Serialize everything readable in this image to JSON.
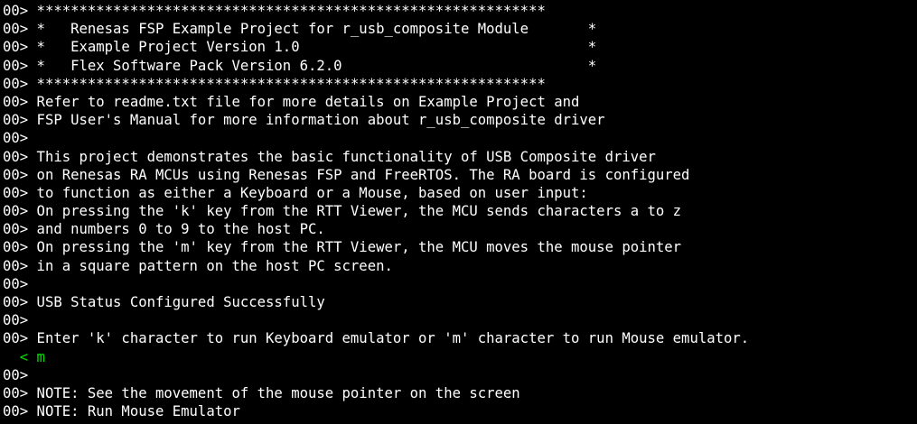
{
  "terminal": {
    "lines": [
      {
        "text": "00> ************************************************************",
        "type": "output"
      },
      {
        "text": "00> *   Renesas FSP Example Project for r_usb_composite Module       *",
        "type": "output"
      },
      {
        "text": "00> *   Example Project Version 1.0                                  *",
        "type": "output"
      },
      {
        "text": "00> *   Flex Software Pack Version 6.2.0                             *",
        "type": "output"
      },
      {
        "text": "00> ************************************************************",
        "type": "output"
      },
      {
        "text": "00> Refer to readme.txt file for more details on Example Project and",
        "type": "output"
      },
      {
        "text": "00> FSP User's Manual for more information about r_usb_composite driver",
        "type": "output"
      },
      {
        "text": "00>",
        "type": "output"
      },
      {
        "text": "00> This project demonstrates the basic functionality of USB Composite driver",
        "type": "output"
      },
      {
        "text": "00> on Renesas RA MCUs using Renesas FSP and FreeRTOS. The RA board is configured",
        "type": "output"
      },
      {
        "text": "00> to function as either a Keyboard or a Mouse, based on user input:",
        "type": "output"
      },
      {
        "text": "00> On pressing the 'k' key from the RTT Viewer, the MCU sends characters a to z",
        "type": "output"
      },
      {
        "text": "00> and numbers 0 to 9 to the host PC.",
        "type": "output"
      },
      {
        "text": "00> On pressing the 'm' key from the RTT Viewer, the MCU moves the mouse pointer",
        "type": "output"
      },
      {
        "text": "00> in a square pattern on the host PC screen.",
        "type": "output"
      },
      {
        "text": "00>",
        "type": "output"
      },
      {
        "text": "00> USB Status Configured Successfully",
        "type": "output"
      },
      {
        "text": "00>",
        "type": "output"
      },
      {
        "text": "00> Enter 'k' character to run Keyboard emulator or 'm' character to run Mouse emulator.",
        "type": "output"
      },
      {
        "text": "  < m",
        "type": "input"
      },
      {
        "text": "00>",
        "type": "output"
      },
      {
        "text": "00> NOTE: See the movement of the mouse pointer on the screen",
        "type": "output"
      },
      {
        "text": "00> NOTE: Run Mouse Emulator",
        "type": "output"
      }
    ],
    "colors": {
      "background": "#000000",
      "output_text": "#ffffff",
      "input_echo": "#00e000"
    }
  }
}
